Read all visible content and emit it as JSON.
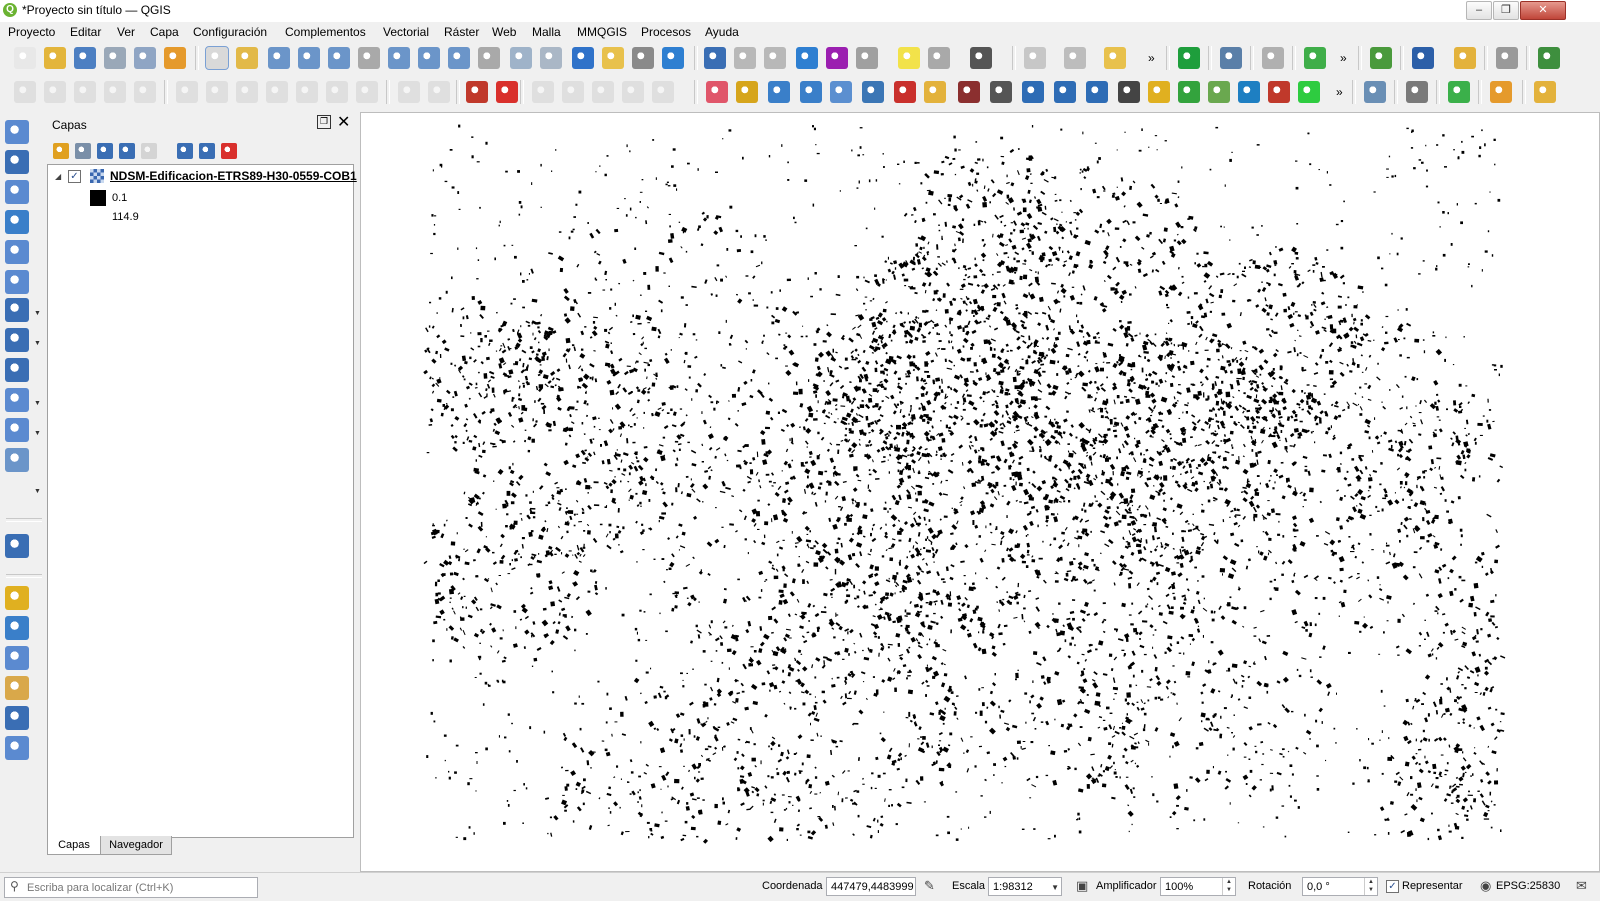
{
  "window": {
    "app_icon_glyph": "Q",
    "title": "*Proyecto sin título — QGIS"
  },
  "menubar": {
    "items": [
      "Proyecto",
      "Editar",
      "Ver",
      "Capa",
      "Configuración",
      "Complementos",
      "Vectorial",
      "Ráster",
      "Web",
      "Malla",
      "MMQGIS",
      "Procesos",
      "Ayuda"
    ]
  },
  "toolbar_overflow_glyph": "»",
  "layers_panel": {
    "title": "Capas",
    "layer": {
      "name": "NDSM-Edificacion-ETRS89-H30-0559-COB1",
      "checked": true,
      "legend_min": "0.1",
      "legend_max": "114.9"
    },
    "tabs": [
      "Capas",
      "Navegador"
    ]
  },
  "map": {
    "background_color": "#ffffff",
    "feature_color": "#000000"
  },
  "statusbar": {
    "locator_placeholder": "Escriba para localizar (Ctrl+K)",
    "coordinate_label": "Coordenada",
    "coordinate_value": "447479,4483999",
    "scale_label": "Escala",
    "scale_value": "1:98312",
    "magnifier_label": "Amplificador",
    "magnifier_value": "100%",
    "rotation_label": "Rotación",
    "rotation_value": "0,0 °",
    "render_label": "Representar",
    "render_checked": true,
    "crs": "EPSG:25830"
  }
}
